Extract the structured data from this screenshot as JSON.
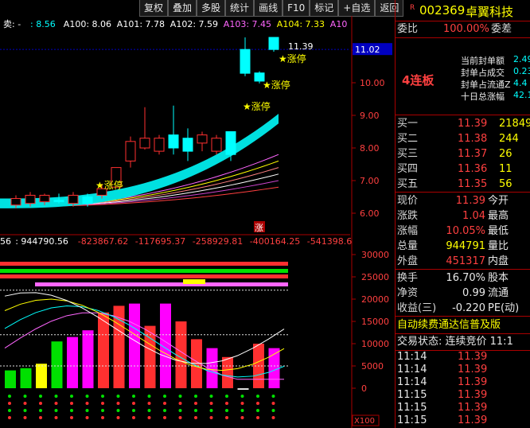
{
  "toolbar": {
    "buttons": [
      "复权",
      "叠加",
      "多股",
      "统计",
      "画线",
      "F10",
      "标记",
      "+自选",
      "返回"
    ]
  },
  "ma_bar": {
    "prefix": "卖: -",
    "items": [
      {
        "label": ": 8.56",
        "color": "#00ffff"
      },
      {
        "label": "A100: 8.06",
        "color": "#ffffff"
      },
      {
        "label": "A101: 7.78",
        "color": "#ffffff"
      },
      {
        "label": "A102: 7.59",
        "color": "#ffffff"
      },
      {
        "label": "A103: 7.45",
        "color": "#ff66ff"
      },
      {
        "label": "A104: 7.33",
        "color": "#ffff00"
      },
      {
        "label": "A10",
        "color": "#ff66ff"
      }
    ]
  },
  "chart_data": {
    "type": "candlestick",
    "price_axis": {
      "ticks": [
        6.0,
        7.0,
        8.0,
        9.0,
        10.0,
        11.0
      ],
      "current": "11.02"
    },
    "candles": [
      {
        "o": 6.25,
        "c": 6.45,
        "h": 6.55,
        "l": 6.15
      },
      {
        "o": 6.3,
        "c": 6.55,
        "h": 6.65,
        "l": 6.2
      },
      {
        "o": 6.35,
        "c": 6.55,
        "h": 6.6,
        "l": 6.25
      },
      {
        "o": 6.4,
        "c": 6.35,
        "h": 6.6,
        "l": 6.3
      },
      {
        "o": 6.3,
        "c": 6.55,
        "h": 6.65,
        "l": 6.2
      },
      {
        "o": 6.5,
        "c": 6.3,
        "h": 6.6,
        "l": 6.2
      },
      {
        "o": 6.55,
        "c": 6.75,
        "h": 6.9,
        "l": 6.45
      },
      {
        "o": 6.8,
        "c": 7.4,
        "h": 7.4,
        "l": 6.8
      },
      {
        "o": 7.6,
        "c": 8.2,
        "h": 8.35,
        "l": 7.4
      },
      {
        "o": 8.0,
        "c": 8.3,
        "h": 9.25,
        "l": 7.95
      },
      {
        "o": 7.9,
        "c": 8.3,
        "h": 8.4,
        "l": 7.8
      },
      {
        "o": 8.4,
        "c": 8.0,
        "h": 9.3,
        "l": 7.8
      },
      {
        "o": 8.3,
        "c": 7.9,
        "h": 8.6,
        "l": 7.6
      },
      {
        "o": 8.15,
        "c": 8.4,
        "h": 8.5,
        "l": 7.9
      },
      {
        "o": 7.9,
        "c": 8.3,
        "h": 8.4,
        "l": 7.8
      },
      {
        "o": 8.5,
        "c": 7.8,
        "h": 8.5,
        "l": 7.6
      },
      {
        "o": 11.02,
        "c": 10.29,
        "h": 11.39,
        "l": 10.2
      },
      {
        "o": 10.3,
        "c": 10.05,
        "h": 10.35,
        "l": 9.98
      },
      {
        "o": 11.39,
        "c": 11.02,
        "h": 11.39,
        "l": 10.95
      }
    ],
    "annotations": [
      "涨停",
      "涨停",
      "涨停",
      "涨停"
    ],
    "high_label": "11.39",
    "volume_axis": {
      "ticks": [
        "30000",
        "25000",
        "20000",
        "15000",
        "10000",
        "5000",
        "0"
      ]
    },
    "volume_header": [
      "56",
      ": 944790.56",
      "-823867.62",
      "-117695.37",
      "-258929.81",
      "-400164.25",
      "-541398.6"
    ],
    "x_label": "X100",
    "vol_bars": [
      4000,
      4500,
      5500,
      10500,
      11500,
      13000,
      17000,
      18500,
      19000,
      14000,
      19000,
      15000,
      11000,
      9000,
      7000,
      0,
      10000,
      9000
    ],
    "indicator_tag": "涨"
  },
  "header": {
    "code": "002369",
    "name": "卓翼科技",
    "r_mark": "R",
    "webi_label": "委比",
    "webi_value": "100.00%",
    "wecha_label": "委差"
  },
  "seal": {
    "tag": "4连板",
    "items": [
      "当前封单额",
      "封单占成交",
      "封单占流通Z",
      "十日总涨幅"
    ],
    "values": [
      "2.49",
      "0.23",
      "4.4",
      "42.1"
    ]
  },
  "bids": [
    {
      "label": "买一",
      "price": "11.39",
      "vol": "21849"
    },
    {
      "label": "买二",
      "price": "11.38",
      "vol": "244"
    },
    {
      "label": "买三",
      "price": "11.37",
      "vol": "26"
    },
    {
      "label": "买四",
      "price": "11.36",
      "vol": "11"
    },
    {
      "label": "买五",
      "price": "11.35",
      "vol": "56"
    }
  ],
  "quote": [
    {
      "label": "现价",
      "value": "11.39",
      "right": "今开"
    },
    {
      "label": "涨跌",
      "value": "1.04",
      "right": "最高"
    },
    {
      "label": "涨幅",
      "value": "10.05%",
      "right": "最低"
    },
    {
      "label": "总量",
      "value": "944791",
      "right": "量比"
    },
    {
      "label": "外盘",
      "value": "451317",
      "right": "内盘"
    }
  ],
  "stats": [
    {
      "label": "换手",
      "value": "16.70%",
      "right": "股本"
    },
    {
      "label": "净资",
      "value": "0.99",
      "right": "流通"
    },
    {
      "label": "收益(三)",
      "value": "-0.220",
      "right": "PE(动)"
    }
  ],
  "scroll_text": "自动续费通达信普及版",
  "trade_status": "交易状态: 连续竞价 11:1",
  "ticks": [
    {
      "time": "11:14",
      "price": "11.39"
    },
    {
      "time": "11:14",
      "price": "11.39"
    },
    {
      "time": "11:14",
      "price": "11.39"
    },
    {
      "time": "11:15",
      "price": "11.39"
    },
    {
      "time": "11:15",
      "price": "11.39"
    },
    {
      "time": "11:15",
      "price": "11.39"
    }
  ]
}
